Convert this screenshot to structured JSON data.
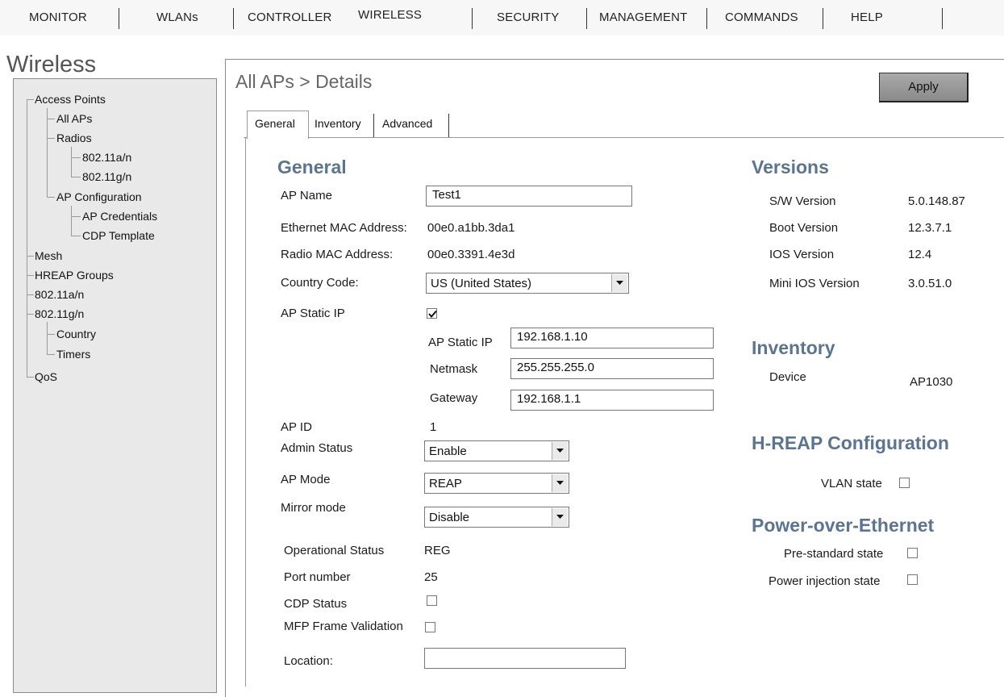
{
  "topnav": {
    "tabs": [
      "MONITOR",
      "WLANs",
      "CONTROLLER",
      "WIRELESS",
      "SECURITY",
      "MANAGEMENT",
      "COMMANDS",
      "HELP"
    ]
  },
  "sidebar": {
    "section_title": "Wireless",
    "tree": {
      "access_points": "Access Points",
      "all_aps": "All APs",
      "radios": "Radios",
      "radio_a": "802.11a/n",
      "radio_g": "802.11g/n",
      "ap_configuration": "AP Configuration",
      "ap_credentials": "AP Credentials",
      "cdp_template": "CDP Template",
      "mesh": "Mesh",
      "hreap_groups": "HREAP Groups",
      "band_a": "802.11a/n",
      "band_g": "802.11g/n",
      "country": "Country",
      "timers": "Timers",
      "qos": "QoS"
    }
  },
  "main": {
    "title": "All APs > Details",
    "apply_label": "Apply",
    "subtabs": [
      "General",
      "Inventory",
      "Advanced"
    ],
    "general": {
      "heading": "General",
      "ap_name_label": "AP Name",
      "ap_name_value": "Test1",
      "eth_mac_label": "Ethernet MAC Address:",
      "eth_mac_value": "00e0.a1bb.3da1",
      "radio_mac_label": "Radio MAC Address:",
      "radio_mac_value": "00e0.3391.4e3d",
      "country_label": "Country Code:",
      "country_value": "US (United States)",
      "static_ip_label": "AP Static IP",
      "static_ip_checked": true,
      "static_ip_sub_label": "AP Static IP",
      "static_ip_value": "192.168.1.10",
      "netmask_label": "Netmask",
      "netmask_value": "255.255.255.0",
      "gateway_label": "Gateway",
      "gateway_value": "192.168.1.1",
      "ap_id_label": "AP ID",
      "ap_id_value": "1",
      "admin_status_label": "Admin Status",
      "admin_status_value": "Enable",
      "ap_mode_label": "AP Mode",
      "ap_mode_value": "REAP",
      "mirror_mode_label": "Mirror mode",
      "mirror_mode_value": "Disable",
      "op_status_label": "Operational Status",
      "op_status_value": "REG",
      "port_label": "Port number",
      "port_value": "25",
      "cdp_label": "CDP Status",
      "mfp_label": "MFP Frame Validation",
      "location_label": "Location:",
      "location_value": ""
    },
    "versions": {
      "heading": "Versions",
      "sw_label": "S/W Version",
      "sw_value": "5.0.148.87",
      "boot_label": "Boot Version",
      "boot_value": "12.3.7.1",
      "ios_label": "IOS Version",
      "ios_value": "12.4",
      "mini_ios_label": "Mini IOS Version",
      "mini_ios_value": "3.0.51.0"
    },
    "inventory": {
      "heading": "Inventory",
      "device_label": "Device",
      "device_value": "AP1030"
    },
    "hreap": {
      "heading": "H-REAP Configuration",
      "vlan_label": "VLAN state"
    },
    "poe": {
      "heading": "Power-over-Ethernet",
      "prestandard_label": "Pre-standard state",
      "injection_label": "Power injection state"
    }
  }
}
